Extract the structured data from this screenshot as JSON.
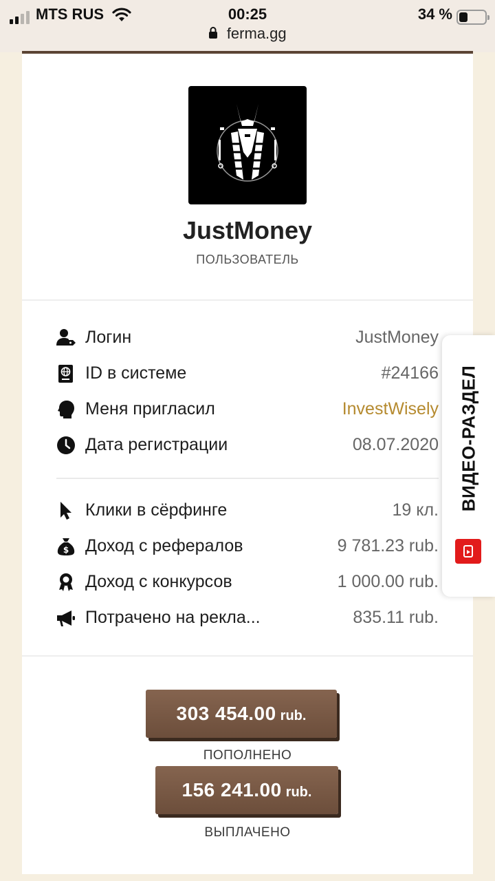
{
  "status_bar": {
    "carrier": "MTS RUS",
    "time": "00:25",
    "battery": "34 %",
    "battery_level": 0.34
  },
  "browser": {
    "url": "ferma.gg"
  },
  "profile": {
    "username": "JustMoney",
    "role": "ПОЛЬЗОВАТЕЛЬ"
  },
  "info": [
    {
      "icon": "user-tag-icon",
      "label": "Логин",
      "value": "JustMoney"
    },
    {
      "icon": "id-card-icon",
      "label": "ID в системе",
      "value": "#24166"
    },
    {
      "icon": "head-profile-icon",
      "label": "Меня пригласил",
      "value": "InvestWisely"
    },
    {
      "icon": "clock-icon",
      "label": "Дата регистрации",
      "value": "08.07.2020"
    }
  ],
  "stats": [
    {
      "icon": "cursor-icon",
      "label": "Клики в сёрфинге",
      "value": "19 кл."
    },
    {
      "icon": "money-bag-icon",
      "label": "Доход с рефералов",
      "value": "9 781.23 rub."
    },
    {
      "icon": "award-icon",
      "label": "Доход с конкурсов",
      "value": "1 000.00 rub."
    },
    {
      "icon": "megaphone-icon",
      "label": "Потрачено на рекла...",
      "value": "835.11 rub."
    }
  ],
  "totals": {
    "deposited": {
      "amount": "303 454.00",
      "currency": "rub.",
      "caption": "ПОПОЛНЕНО"
    },
    "withdrawn": {
      "amount": "156 241.00",
      "currency": "rub.",
      "caption": "ВЫПЛАЧЕНО"
    }
  },
  "side_tab": {
    "label": "ВИДЕО-РАЗДЕЛ",
    "icon": "youtube-icon"
  },
  "colors": {
    "accent_brown": "#6c4e3b",
    "link_gold": "#b58a2f",
    "page_bg": "#f6efe0",
    "video_red": "#e21b1b"
  }
}
